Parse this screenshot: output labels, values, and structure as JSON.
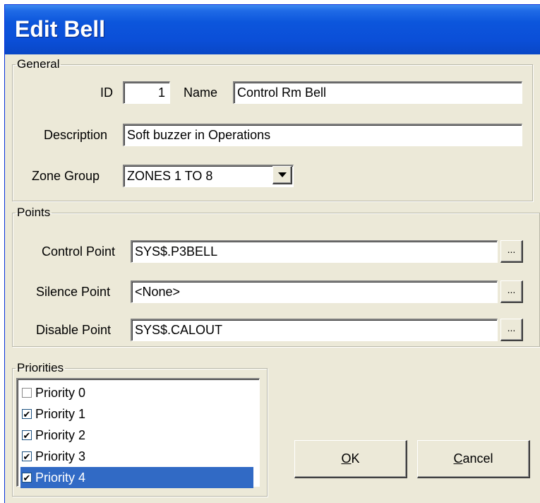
{
  "window": {
    "title": "Edit Bell"
  },
  "general": {
    "legend": "General",
    "id_label": "ID",
    "id_value": "1",
    "name_label": "Name",
    "name_value": "Control Rm Bell",
    "description_label": "Description",
    "description_value": "Soft buzzer in Operations",
    "zone_group_label": "Zone Group",
    "zone_group_value": "ZONES 1 TO 8"
  },
  "points": {
    "legend": "Points",
    "control_label": "Control Point",
    "control_value": "SYS$.P3BELL",
    "silence_label": "Silence Point",
    "silence_value": "<None>",
    "disable_label": "Disable Point",
    "disable_value": "SYS$.CALOUT",
    "browse_label": "..."
  },
  "priorities": {
    "legend": "Priorities",
    "items": [
      {
        "label": "Priority 0",
        "checked": false
      },
      {
        "label": "Priority 1",
        "checked": true
      },
      {
        "label": "Priority 2",
        "checked": true
      },
      {
        "label": "Priority 3",
        "checked": true
      },
      {
        "label": "Priority 4",
        "checked": true,
        "selected": true
      }
    ]
  },
  "buttons": {
    "ok_label": "OK",
    "cancel_label": "Cancel"
  },
  "colors": {
    "titlebar": "#0b4fd8",
    "face": "#ece9d8",
    "selection": "#316ac5"
  }
}
